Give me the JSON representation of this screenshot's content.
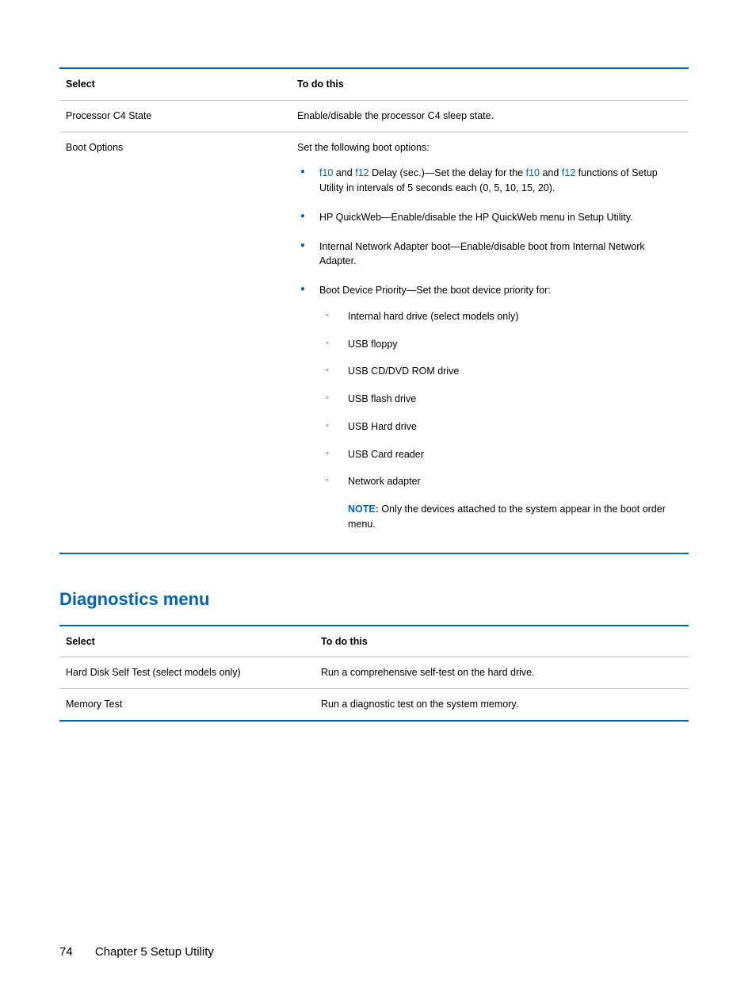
{
  "table1": {
    "headers": {
      "select": "Select",
      "action": "To do this"
    },
    "rows": [
      {
        "select": "Processor C4 State",
        "action": "Enable/disable the processor C4 sleep state."
      },
      {
        "select": "Boot Options",
        "action_intro": "Set the following boot options:",
        "bullets": [
          {
            "pre": "",
            "key1": "f10",
            "mid1": " and ",
            "key2": "f12",
            "mid2": " Delay (sec.)—Set the delay for the ",
            "key3": "f10",
            "mid3": " and ",
            "key4": "f12",
            "post": " functions of Setup Utility in intervals of 5 seconds each (0, 5, 10, 15, 20)."
          },
          {
            "text": "HP QuickWeb—Enable/disable the HP QuickWeb menu in Setup Utility."
          },
          {
            "text": "Internal Network Adapter boot—Enable/disable boot from Internal Network Adapter."
          },
          {
            "text": "Boot Device Priority—Set the boot device priority for:",
            "sub": [
              "Internal hard drive (select models only)",
              "USB floppy",
              "USB CD/DVD ROM drive",
              "USB flash drive",
              "USB Hard drive",
              "USB Card reader",
              "Network adapter"
            ],
            "note_label": "NOTE:",
            "note_text": "   Only the devices attached to the system appear in the boot order menu."
          }
        ]
      }
    ]
  },
  "heading": "Diagnostics menu",
  "table2": {
    "headers": {
      "select": "Select",
      "action": "To do this"
    },
    "rows": [
      {
        "select": "Hard Disk Self Test (select models only)",
        "action": "Run a comprehensive self-test on the hard drive."
      },
      {
        "select": "Memory Test",
        "action": "Run a diagnostic test on the system memory."
      }
    ]
  },
  "footer": {
    "page": "74",
    "chapter": "Chapter 5   Setup Utility"
  }
}
